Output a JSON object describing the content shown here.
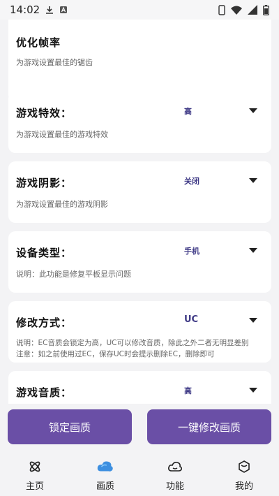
{
  "status_bar": {
    "time": "14:02",
    "icons": [
      "download-icon",
      "a-notification-icon",
      "phone-icon",
      "wifi-icon",
      "signal-icon",
      "battery-icon"
    ]
  },
  "cards": [
    {
      "title": "优化帧率",
      "value": "",
      "description": "为游戏设置最佳的锯齿"
    },
    {
      "title": "游戏特效：",
      "value": "高",
      "description": "为游戏设置最佳的游戏特效"
    },
    {
      "title": "游戏阴影：",
      "value": "关闭",
      "description": "为游戏设置最佳的游戏阴影"
    },
    {
      "title": "设备类型：",
      "value": "手机",
      "description": "说明：此功能是修复平板显示问题"
    },
    {
      "title": "修改方式：",
      "value": "UC",
      "description_lines": [
        "说明：EC音质会锁定为高，UC可以修改音质，除此之外二者无明显差别",
        "注意：如之前使用过EC，保存UC时会提示删除EC，删除即可"
      ]
    },
    {
      "title": "游戏音质：",
      "value": "高"
    }
  ],
  "buttons": {
    "lock": "锁定画质",
    "modify": "一键修改画质"
  },
  "nav": [
    {
      "label": "主页",
      "icon": "atom-icon"
    },
    {
      "label": "画质",
      "icon": "blue-cloud-icon",
      "active": true
    },
    {
      "label": "功能",
      "icon": "cloud-icon"
    },
    {
      "label": "我的",
      "icon": "cube-icon"
    }
  ],
  "colors": {
    "accent": "#6a4fa6",
    "value_text": "#3f3a86",
    "active_nav": "#3d8fe0"
  }
}
